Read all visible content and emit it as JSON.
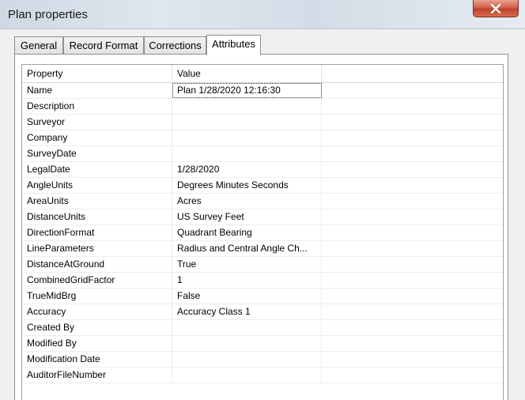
{
  "window": {
    "title": "Plan properties"
  },
  "tabs": [
    {
      "label": "General"
    },
    {
      "label": "Record Format"
    },
    {
      "label": "Corrections"
    },
    {
      "label": "Attributes"
    }
  ],
  "grid": {
    "headers": {
      "property": "Property",
      "value": "Value"
    },
    "rows": [
      {
        "property": "Name",
        "value": "Plan 1/28/2020 12:16:30"
      },
      {
        "property": "Description",
        "value": ""
      },
      {
        "property": "Surveyor",
        "value": ""
      },
      {
        "property": "Company",
        "value": ""
      },
      {
        "property": "SurveyDate",
        "value": ""
      },
      {
        "property": "LegalDate",
        "value": "1/28/2020"
      },
      {
        "property": "AngleUnits",
        "value": "Degrees Minutes Seconds"
      },
      {
        "property": "AreaUnits",
        "value": "Acres"
      },
      {
        "property": "DistanceUnits",
        "value": "US Survey Feet"
      },
      {
        "property": "DirectionFormat",
        "value": "Quadrant Bearing"
      },
      {
        "property": "LineParameters",
        "value": "Radius and Central Angle Ch..."
      },
      {
        "property": "DistanceAtGround",
        "value": "True"
      },
      {
        "property": "CombinedGridFactor",
        "value": "1"
      },
      {
        "property": "TrueMidBrg",
        "value": "False"
      },
      {
        "property": "Accuracy",
        "value": "Accuracy Class 1"
      },
      {
        "property": "Created By",
        "value": ""
      },
      {
        "property": "Modified By",
        "value": ""
      },
      {
        "property": "Modification Date",
        "value": ""
      },
      {
        "property": "AuditorFileNumber",
        "value": ""
      }
    ]
  },
  "icons": {
    "close": "close-icon"
  }
}
